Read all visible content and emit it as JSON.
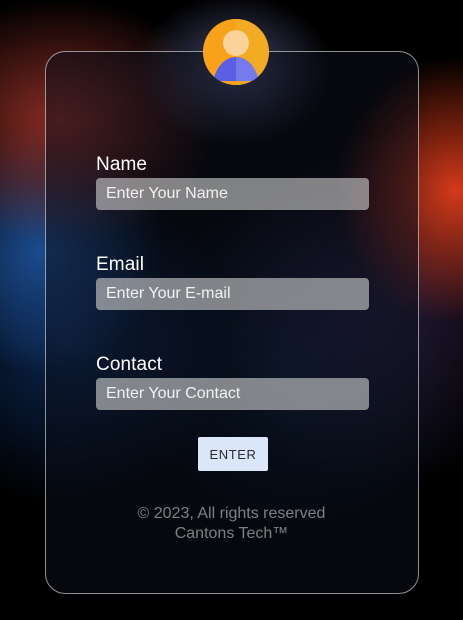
{
  "form": {
    "fields": [
      {
        "label": "Name",
        "placeholder": "Enter Your Name",
        "value": ""
      },
      {
        "label": "Email",
        "placeholder": "Enter Your E-mail",
        "value": ""
      },
      {
        "label": "Contact",
        "placeholder": "Enter Your Contact",
        "value": ""
      }
    ],
    "submit_label": "ENTER"
  },
  "footer": {
    "line1": "© 2023, All rights reserved",
    "line2": "Cantons Tech™"
  },
  "icons": {
    "avatar": "user-avatar-icon"
  },
  "colors": {
    "avatar_orange": "#f8a21a",
    "avatar_orange_light": "#f2b12b",
    "avatar_face": "#f9d39a",
    "avatar_body": "#5b5fe6",
    "button_bg": "#dbe7f8"
  }
}
